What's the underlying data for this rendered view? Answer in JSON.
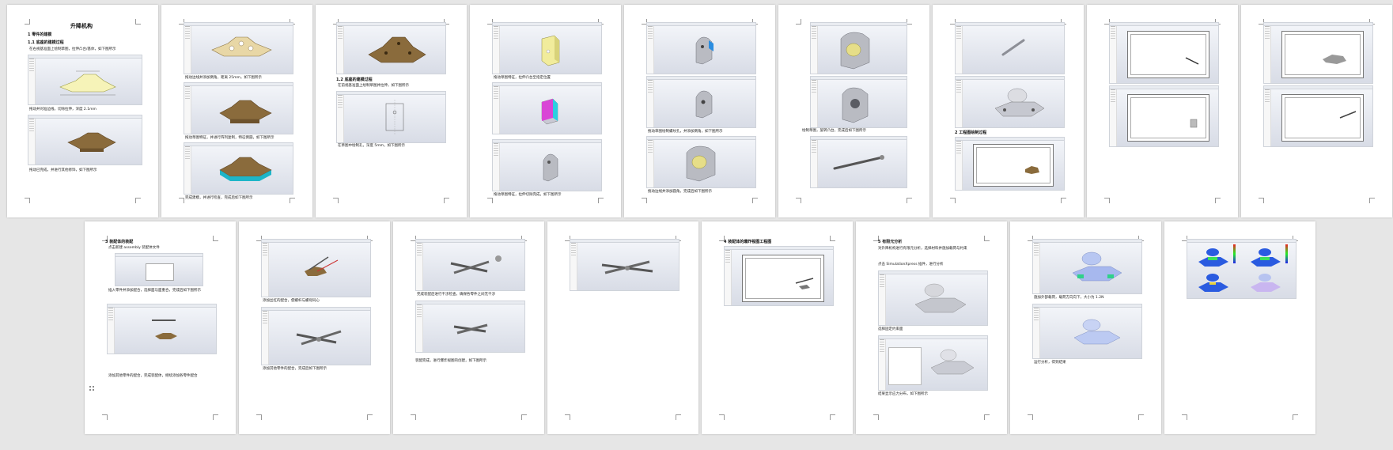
{
  "p1": {
    "title": "升降机构",
    "s1": "1 零件的建模",
    "s11": "1.1 底座的建模过程",
    "b1": "在右视基准面上绘制草图，拉伸凸台/基体，如下图所示",
    "b2": "拖动并对准边线，切除拉伸，深度 2.1mm",
    "b3": "拖动已完成，并进行其他修饰，如下图所示"
  },
  "p2": {
    "b1": "拖动边线并添加倒角，距离 25mm，如下图所示",
    "b2": "拖动草图特征，并进行阵列复制，特征倒圆，如下图所示",
    "b3": "完成建模，并进行检查，完成后如下图所示"
  },
  "p3": {
    "h": "1.2 底座的建模过程",
    "b1": "在前视基准面上绘制草图并拉伸，如下图所示",
    "b2": "在草图中绘制孔，深度 5mm，如下图所示"
  },
  "p4": {
    "b1": "拖动草图特征，拉伸凸台至指定位置",
    "b2": "拖动草图特征，拉伸切除完成，如下图所示"
  },
  "p5": {
    "b1": "拖动草图绘制螺纹孔，并添加倒角，如下图所示",
    "b2": "拖动边线并添加圆角，完成后如下图所示"
  },
  "p6": {
    "b1": "绘制草图，旋转凸台，完成后如下图所示"
  },
  "p7": {
    "h": "2 工程图绘制过程"
  },
  "p10": {
    "h": "3 装配体的装配",
    "b1": "点击新建 assembly 装配体文件",
    "b2": "插入零件并添加配合，选择面与面重合，完成后如下图所示",
    "b3": "添加其他零件的配合，完成装配体，继续添加各零件配合"
  },
  "p11": {
    "b1": "添加丝杠的配合，使螺杆与螺母同心",
    "b2": "添加其他零件的配合，完成后如下图所示"
  },
  "p12": {
    "b1": "完成装配后进行干涉检查，确保各零件之间无干涉",
    "b2": "装配完成，进行爆炸视图的创建，如下图所示"
  },
  "p14": {
    "h": "4 装配体的爆炸视图工程图"
  },
  "p15": {
    "h": "5 有限元分析",
    "t1": "对升降机构进行有限元分析，选择材料并施加载荷与约束",
    "t2": "点击 SimulationXpress 插件，进行分析",
    "t3": "选择固定约束面",
    "t4": "结果显示应力分布，如下图所示"
  },
  "p16": {
    "t1": "施加外部载荷，载荷方向向下，大小为 1.2N",
    "t2": "运行分析，得到结果"
  }
}
